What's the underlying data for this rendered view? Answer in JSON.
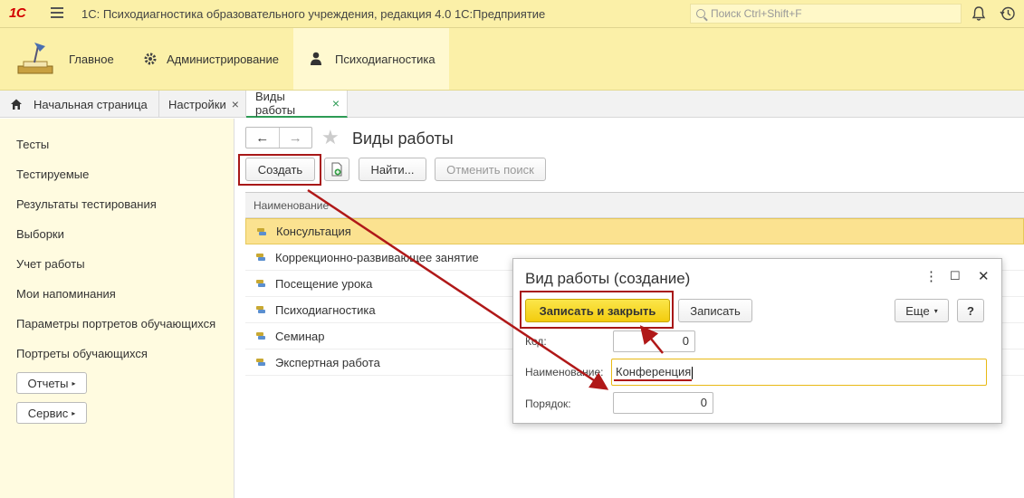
{
  "app": {
    "logo": "1С",
    "title": "1С: Психодиагностика образовательного учреждения, редакция 4.0 1С:Предприятие",
    "search_placeholder": "Поиск Ctrl+Shift+F"
  },
  "sections": [
    {
      "label": "Главное",
      "icon": "desk-lamp-icon"
    },
    {
      "label": "Администрирование",
      "icon": "gear-icon"
    },
    {
      "label": "Психодиагностика",
      "icon": "person-icon",
      "active": true
    }
  ],
  "tabs": [
    {
      "label": "Начальная страница",
      "icon": "home-icon"
    },
    {
      "label": "Настройки",
      "close": "×"
    },
    {
      "label": "Виды работы",
      "close": "×",
      "active": true
    }
  ],
  "sidebar": {
    "items": [
      "Тесты",
      "Тестируемые",
      "Результаты тестирования",
      "Выборки",
      "Учет работы",
      "Мои напоминания",
      "Параметры портретов обучающихся",
      "Портреты обучающихся"
    ],
    "buttons": [
      "Отчеты",
      "Сервис"
    ]
  },
  "form": {
    "title": "Виды работы",
    "nav_back": "←",
    "nav_forward": "→",
    "create_label": "Создать",
    "find_label": "Найти...",
    "cancel_search_label": "Отменить поиск",
    "column_header": "Наименование",
    "rows": [
      "Консультация",
      "Коррекционно-развивающее занятие",
      "Посещение урока",
      "Психодиагностика",
      "Семинар",
      "Экспертная работа"
    ],
    "selected_row": 0
  },
  "dialog": {
    "title": "Вид работы (создание)",
    "menu": "⋮",
    "maximize": "☐",
    "close": "✕",
    "save_close_label": "Записать и закрыть",
    "save_label": "Записать",
    "more_label": "Еще",
    "help_label": "?",
    "code_label": "Код:",
    "code_value": "0",
    "name_label": "Наименование:",
    "name_value": "Конференция",
    "order_label": "Порядок:",
    "order_value": "0"
  },
  "colors": {
    "title_bar": "#fbf0a8",
    "accent_green": "#2d9b55",
    "primary_button": "#f3cc0e",
    "annotation_red": "#a81818",
    "selected_row": "#fbe290"
  }
}
